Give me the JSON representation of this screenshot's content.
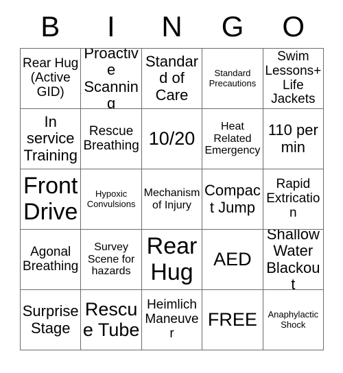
{
  "card": {
    "header_letters": [
      "B",
      "I",
      "N",
      "G",
      "O"
    ],
    "rows": [
      [
        {
          "text": "Rear Hug (Active GID)",
          "size": "m"
        },
        {
          "text": "Proactive Scanning",
          "size": "l"
        },
        {
          "text": "Standard of Care",
          "size": "l"
        },
        {
          "text": "Standard Precautions",
          "size": "xs"
        },
        {
          "text": "Swim Lessons+ Life Jackets",
          "size": "m"
        }
      ],
      [
        {
          "text": "In service Training",
          "size": "l"
        },
        {
          "text": "Rescue Breathing",
          "size": "m"
        },
        {
          "text": "10/20",
          "size": "xl"
        },
        {
          "text": "Heat Related Emergency",
          "size": "s"
        },
        {
          "text": "110 per min",
          "size": "l"
        }
      ],
      [
        {
          "text": "Front Drive",
          "size": "xxl"
        },
        {
          "text": "Hypoxic Convulsions",
          "size": "xs"
        },
        {
          "text": "Mechanism of Injury",
          "size": "s"
        },
        {
          "text": "Compact Jump",
          "size": "l"
        },
        {
          "text": "Rapid Extrication",
          "size": "m"
        }
      ],
      [
        {
          "text": "Agonal Breathing",
          "size": "m"
        },
        {
          "text": "Survey Scene for hazards",
          "size": "s"
        },
        {
          "text": "Rear Hug",
          "size": "xxl"
        },
        {
          "text": "AED",
          "size": "xl"
        },
        {
          "text": "Shallow Water Blackout",
          "size": "l"
        }
      ],
      [
        {
          "text": "Surprise Stage",
          "size": "l"
        },
        {
          "text": "Rescue Tube",
          "size": "xl"
        },
        {
          "text": "Heimlich Maneuver",
          "size": "m"
        },
        {
          "text": "FREE",
          "size": "xl"
        },
        {
          "text": "Anaphylactic Shock",
          "size": "xs"
        }
      ]
    ]
  },
  "colors": {
    "grid_line": "#6b6b6b",
    "text": "#000000",
    "background": "#ffffff"
  }
}
